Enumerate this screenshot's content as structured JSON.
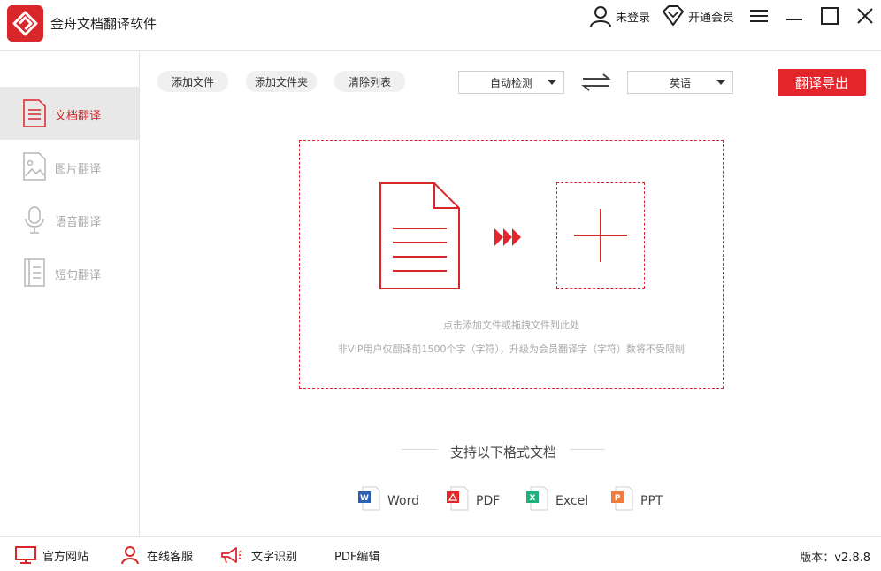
{
  "app": {
    "title": "金舟文档翻译软件"
  },
  "titlebar": {
    "login_label": "未登录",
    "vip_label": "开通会员"
  },
  "sidebar": {
    "items": [
      {
        "label": "文档翻译",
        "icon": "document-icon",
        "active": true
      },
      {
        "label": "图片翻译",
        "icon": "image-icon",
        "active": false
      },
      {
        "label": "语音翻译",
        "icon": "microphone-icon",
        "active": false
      },
      {
        "label": "短句翻译",
        "icon": "notebook-icon",
        "active": false
      }
    ]
  },
  "toolbar": {
    "add_file": "添加文件",
    "add_folder": "添加文件夹",
    "clear_list": "清除列表",
    "source_lang": "自动检测",
    "target_lang": "英语",
    "export_label": "翻译导出"
  },
  "dropzone": {
    "hint": "点击添加文件或拖拽文件到此处",
    "limit_note": "非VIP用户仅翻译前1500个字（字符），升级为会员翻译字（字符）数将不受限制"
  },
  "formats": {
    "title": "支持以下格式文档",
    "items": [
      {
        "label": "Word",
        "icon": "word-icon",
        "color": "#2b5fb4"
      },
      {
        "label": "PDF",
        "icon": "pdf-icon",
        "color": "#e3262b"
      },
      {
        "label": "Excel",
        "icon": "excel-icon",
        "color": "#1fb07c"
      },
      {
        "label": "PPT",
        "icon": "ppt-icon",
        "color": "#f07b3f"
      }
    ]
  },
  "bottombar": {
    "website": "官方网站",
    "support": "在线客服",
    "ocr": "文字识别",
    "pdf_edit": "PDF编辑",
    "version": "版本：v2.8.8"
  },
  "colors": {
    "accent": "#d9262b",
    "sidebar_active_bg": "#e8e8e8"
  }
}
